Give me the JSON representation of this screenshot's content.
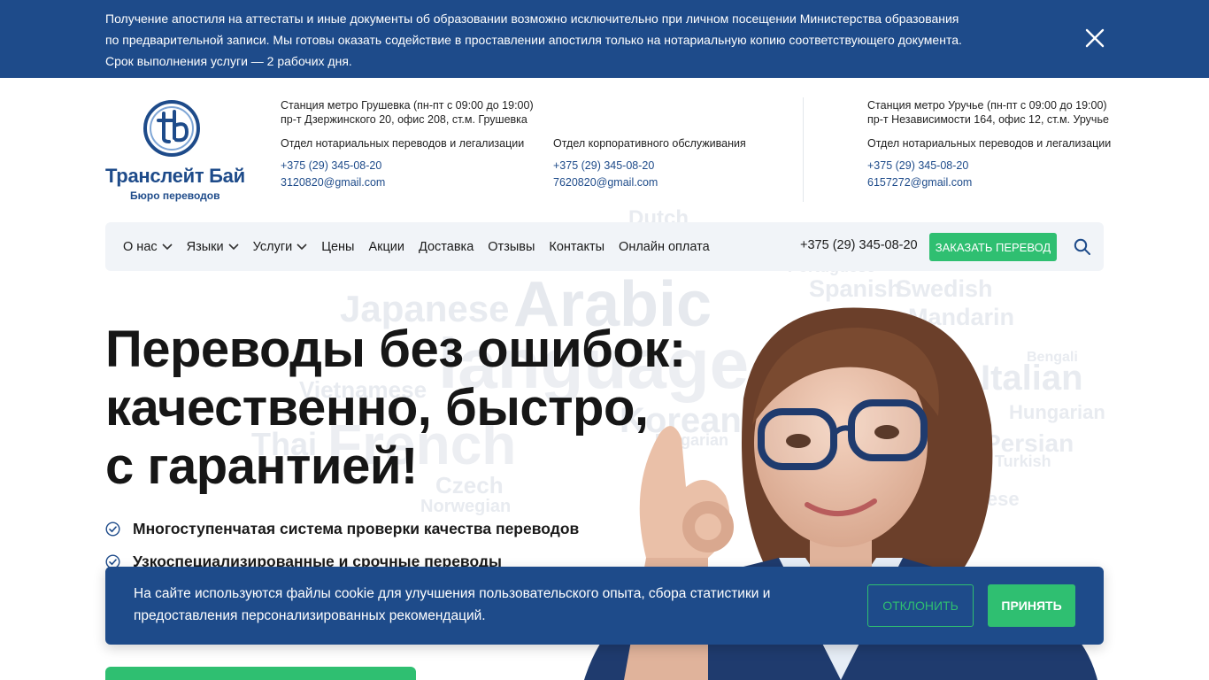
{
  "notice": {
    "line1": "Получение апостиля на аттестаты и иные документы об образовании возможно исключительно при личном посещении Министерства образования",
    "line2": "по предварительной записи. Мы готовы оказать содействие в проставлении апостиля только на нотариальную копию соответствующего документа.",
    "line3": "Срок выполнения услуги — 2 рабочих дня.",
    "close_icon": "close-icon"
  },
  "brand": {
    "name": "Транслейт Бай",
    "subtitle": "Бюро переводов",
    "logo_icon": "tb-logo-icon",
    "color": "#1e4b8a"
  },
  "offices": {
    "grushevka": {
      "hours": "Станция метро Грушевка (пн-пт с 09:00 до 19:00)",
      "address": "пр-т Дзержинского 20, офис 208, ст.м. Грушевка",
      "dept": "Отдел нотариальных переводов и легализации",
      "phone": "+375 (29) 345-08-20",
      "email": "3120820@gmail.com"
    },
    "corporate": {
      "dept": "Отдел корпоративного обслуживания",
      "phone": "+375 (29) 345-08-20",
      "email": "7620820@gmail.com"
    },
    "uruchye": {
      "hours": "Станция метро Уручье (пн-пт с 09:00 до 19:00)",
      "address": "пр-т Независимости 164, офис 12, ст.м. Уручье",
      "dept": "Отдел нотариальных переводов и легализации",
      "phone": "+375 (29) 345-08-20",
      "email": "6157272@gmail.com"
    }
  },
  "nav": {
    "items": [
      {
        "label": "О нас",
        "dropdown": true
      },
      {
        "label": "Языки",
        "dropdown": true
      },
      {
        "label": "Услуги",
        "dropdown": true
      },
      {
        "label": "Цены",
        "dropdown": false
      },
      {
        "label": "Акции",
        "dropdown": false
      },
      {
        "label": "Доставка",
        "dropdown": false
      },
      {
        "label": "Отзывы",
        "dropdown": false
      },
      {
        "label": "Контакты",
        "dropdown": false
      },
      {
        "label": "Онлайн оплата",
        "dropdown": false
      }
    ],
    "phone": "+375 (29) 345-08-20",
    "order_label": "ЗАКАЗАТЬ ПЕРЕВОД",
    "search_icon": "search-icon",
    "accent": "#2fbf71"
  },
  "hero": {
    "title_line1": "Переводы без ошибок:",
    "title_line2": "качественно, быстро,",
    "title_line3": "с гарантией!",
    "features": [
      "Многоступенчатая система проверки качества переводов",
      "Узкоспециализированные и срочные переводы"
    ],
    "check_icon": "check-circle-icon",
    "word_cloud": [
      "Arabic",
      "language",
      "Japanese",
      "Spanish",
      "Swedish",
      "Mandarin",
      "French",
      "Italian",
      "Vietnamese",
      "Hungarian",
      "Korean",
      "Persian",
      "Czech",
      "Norwegian",
      "Thai",
      "Bengali",
      "Portuguese",
      "Dutch",
      "Turkish",
      "Bulgarian",
      "Chinese"
    ]
  },
  "cookie": {
    "line1": "На сайте используются файлы cookie для улучшения пользовательского опыта, сбора статистики и",
    "line2": "предоставления персонализированных рекомендаций.",
    "decline_label": "ОТКЛОНИТЬ",
    "accept_label": "ПРИНЯТЬ"
  }
}
